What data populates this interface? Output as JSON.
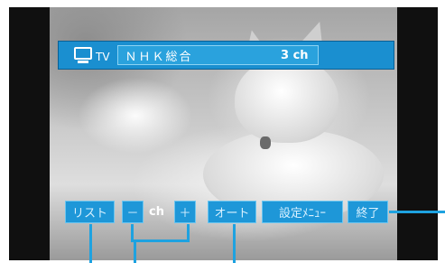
{
  "tv_bar": {
    "label": "TV",
    "channel_name": "ＮＨＫ総合",
    "channel_number": "3 ch"
  },
  "controls": {
    "list": "リスト",
    "minus": "－",
    "ch_label": "ch",
    "plus": "＋",
    "auto": "オート",
    "settings": "設定ﾒﾆｭｰ",
    "exit": "終了"
  },
  "colors": {
    "accent": "#1a8fd0",
    "button": "#1e97d8",
    "callout": "#1ea2e0"
  },
  "icons": {
    "tv": "tv-icon"
  }
}
